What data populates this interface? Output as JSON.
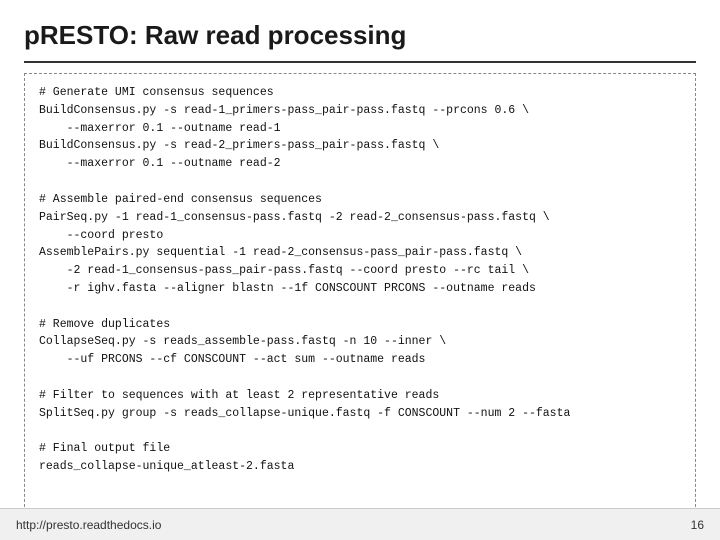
{
  "slide": {
    "title": "pRESTO: Raw read processing",
    "code": {
      "sections": [
        {
          "comment": "# Generate UMI consensus sequences",
          "lines": [
            "BuildConsensus.py -s read-1_primers-pass_pair-pass.fastq --prcons 0.6 \\",
            "    --maxerror 0.1 --outname read-1",
            "BuildConsensus.py -s read-2_primers-pass_pair-pass.fastq \\",
            "    --maxerror 0.1 --outname read-2"
          ]
        },
        {
          "comment": "# Assemble paired-end consensus sequences",
          "lines": [
            "PairSeq.py -1 read-1_consensus-pass.fastq -2 read-2_consensus-pass.fastq \\",
            "    --coord presto",
            "AssemblePairs.py sequential -1 read-2_consensus-pass_pair-pass.fastq \\",
            "    -2 read-1_consensus-pass_pair-pass.fastq --coord presto --rc tail \\",
            "    -r ighv.fasta --aligner blastn --1f CONSCOUNT PRCONS --outname reads"
          ]
        },
        {
          "comment": "# Remove duplicates",
          "lines": [
            "CollapseSeq.py -s reads_assemble-pass.fastq -n 10 --inner \\",
            "    --uf PRCONS --cf CONSCOUNT --act sum --outname reads"
          ]
        },
        {
          "comment": "# Filter to sequences with at least 2 representative reads",
          "lines": [
            "SplitSeq.py group -s reads_collapse-unique.fastq -f CONSCOUNT --num 2 --fasta"
          ]
        },
        {
          "comment": "# Final output file",
          "lines": [
            "reads_collapse-unique_atleast-2.fasta"
          ]
        }
      ]
    },
    "footer": {
      "url": "http://presto.readthedocs.io",
      "page": "16"
    }
  }
}
